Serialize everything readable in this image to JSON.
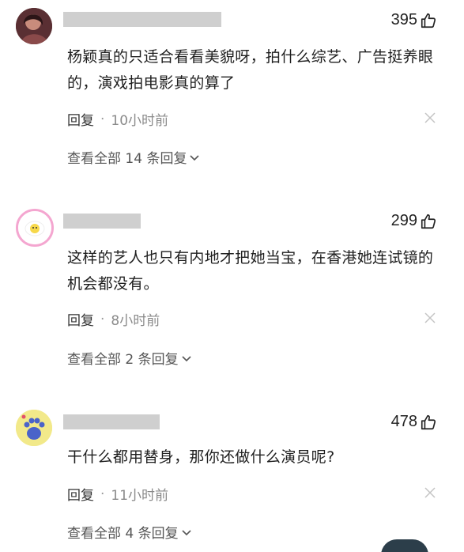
{
  "comments": [
    {
      "likes": "395",
      "text": "杨颖真的只适合看看美貌呀，拍什么综艺、广告挺养眼的，演戏拍电影真的算了",
      "reply_label": "回复",
      "time": "10小时前",
      "view_all": "查看全部 14 条回复",
      "avatar_color": "#6b3b3a"
    },
    {
      "likes": "299",
      "text": "这样的艺人也只有内地才把她当宝，在香港她连试镜的机会都没有。",
      "reply_label": "回复",
      "time": "8小时前",
      "view_all": "查看全部 2 条回复",
      "avatar_color": "#f4a6d0"
    },
    {
      "likes": "478",
      "text": "干什么都用替身，那你还做什么演员呢?",
      "reply_label": "回复",
      "time": "11小时前",
      "view_all": "查看全部 4 条回复",
      "avatar_color": "#f2e98a"
    }
  ],
  "separator": "·",
  "icons": {
    "like": "thumbs-up-icon",
    "close": "close-icon",
    "expand": "chevron-down-icon"
  }
}
